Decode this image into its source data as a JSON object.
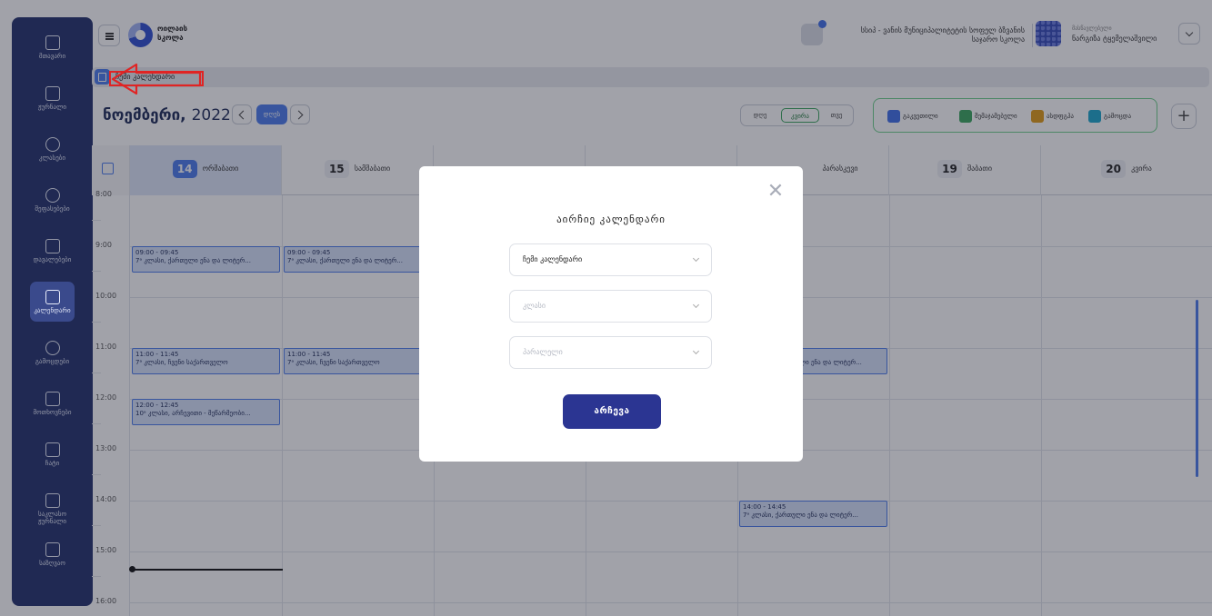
{
  "sidebar": {
    "items": [
      {
        "label": "მთავარი",
        "icon": "grid-icon"
      },
      {
        "label": "ჟურნალი",
        "icon": "journal-icon"
      },
      {
        "label": "კლასები",
        "icon": "users-icon"
      },
      {
        "label": "შეფასებები",
        "icon": "chart-icon"
      },
      {
        "label": "დავალებები",
        "icon": "task-icon"
      },
      {
        "label": "კალენდარი",
        "icon": "calendar-icon",
        "active": true
      },
      {
        "label": "გამოცდები",
        "icon": "shield-icon"
      },
      {
        "label": "მოთხოვნები",
        "icon": "document-icon"
      },
      {
        "label": "ჩატი",
        "icon": "chat-icon"
      },
      {
        "label": "საკლასო ჟურნალი",
        "icon": "clipboard-icon"
      },
      {
        "label": "საზღვაო",
        "icon": "backpack-icon"
      }
    ]
  },
  "header": {
    "app_name_line1": "ოილაის",
    "app_name_line2": "სკოლა",
    "school_line1": "სსიპ - ვანის მუნიციპალიტეტის სოფელ ბზვანის",
    "school_line2": "საჯარო სკოლა",
    "user_role": "მასწავლებელი",
    "user_name": "ნარგიზა ტყემელაშვილი"
  },
  "breadcrumb": {
    "label": "ჩემი კალენდარი"
  },
  "toolbar": {
    "month": "ნოემბერი,",
    "year": "2022",
    "today_label": "დღეს",
    "views": [
      {
        "label": "დღე"
      },
      {
        "label": "კვირა",
        "active": true
      },
      {
        "label": "თვე"
      }
    ]
  },
  "legend": [
    {
      "label": "გაკვეთილი",
      "color": "#3f6ee8"
    },
    {
      "label": "შემაჯამებელი",
      "color": "#3aa65d"
    },
    {
      "label": "ასდფგჰა",
      "color": "#e09a14"
    },
    {
      "label": "გამოცდა",
      "color": "#1aa6cc"
    }
  ],
  "calendar": {
    "days": [
      {
        "num": "14",
        "name": "ორშაბათი",
        "today": true
      },
      {
        "num": "15",
        "name": "სამშაბათი"
      },
      {
        "num": "",
        "name": ""
      },
      {
        "num": "",
        "name": ""
      },
      {
        "num": "",
        "name": "პარასკევი"
      },
      {
        "num": "19",
        "name": "შაბათი"
      },
      {
        "num": "20",
        "name": "კვირა"
      }
    ],
    "times": [
      "8:00",
      "9:00",
      "10:00",
      "11:00",
      "12:00",
      "13:00",
      "14:00",
      "15:00",
      "16:00"
    ],
    "events": [
      {
        "time": "09:00 - 09:45",
        "title": "7ᵃ კლასი, ქართული ენა და ლიტერ..."
      },
      {
        "time": "09:00 - 09:45",
        "title": "7ᵃ კლასი, ქართული ენა და ლიტერ..."
      },
      {
        "time": "11:00 - 11:45",
        "title": "7ᵃ კლასი, ჩვენი საქართველო"
      },
      {
        "time": "11:00 - 11:45",
        "title": "7ᵃ კლასი, ჩვენი საქართველო"
      },
      {
        "time": "",
        "title": "ული ენა და ლიტერ..."
      },
      {
        "time": "12:00 - 12:45",
        "title": "10ᵃ კლასი, არჩევითი - მეწარმეობი..."
      },
      {
        "time": "14:00 - 14:45",
        "title": "7ᵃ კლასი, ქართული ენა და ლიტერ..."
      }
    ]
  },
  "modal": {
    "title": "აირჩიე კალენდარი",
    "calendar_select": "ჩემი კალენდარი",
    "class_placeholder": "კლასი",
    "parallel_placeholder": "პარალელი",
    "submit_label": "არჩევა"
  }
}
